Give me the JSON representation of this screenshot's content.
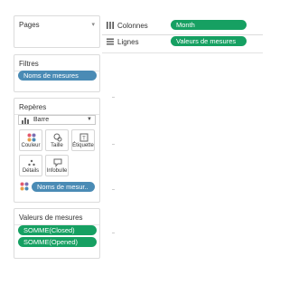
{
  "pages_card": {
    "title": "Pages",
    "arrow": "▾"
  },
  "filters_card": {
    "title": "Filtres",
    "pill": "Noms de mesures"
  },
  "marks_card": {
    "title": "Repères",
    "mark_type": "Barre",
    "buttons": [
      {
        "label": "Couleur",
        "icon": "color-dots-icon"
      },
      {
        "label": "Taille",
        "icon": "size-icon"
      },
      {
        "label": "Étiquette",
        "icon": "label-icon"
      },
      {
        "label": "Détails",
        "icon": "detail-icon"
      },
      {
        "label": "Infobulle",
        "icon": "tooltip-icon"
      }
    ],
    "color_pill": "Noms de mesur.."
  },
  "values_card": {
    "title": "Valeurs de mesures",
    "pills": [
      "SOMME(Closed)",
      "SOMME(Opened)"
    ]
  },
  "shelves": {
    "columns": {
      "label": "Colonnes",
      "pill": "Month"
    },
    "rows": {
      "label": "Lignes",
      "pill": "Valeurs de mesures"
    }
  },
  "colors": {
    "blue_pill": "#4a8bb5",
    "green_pill": "#16a062"
  }
}
